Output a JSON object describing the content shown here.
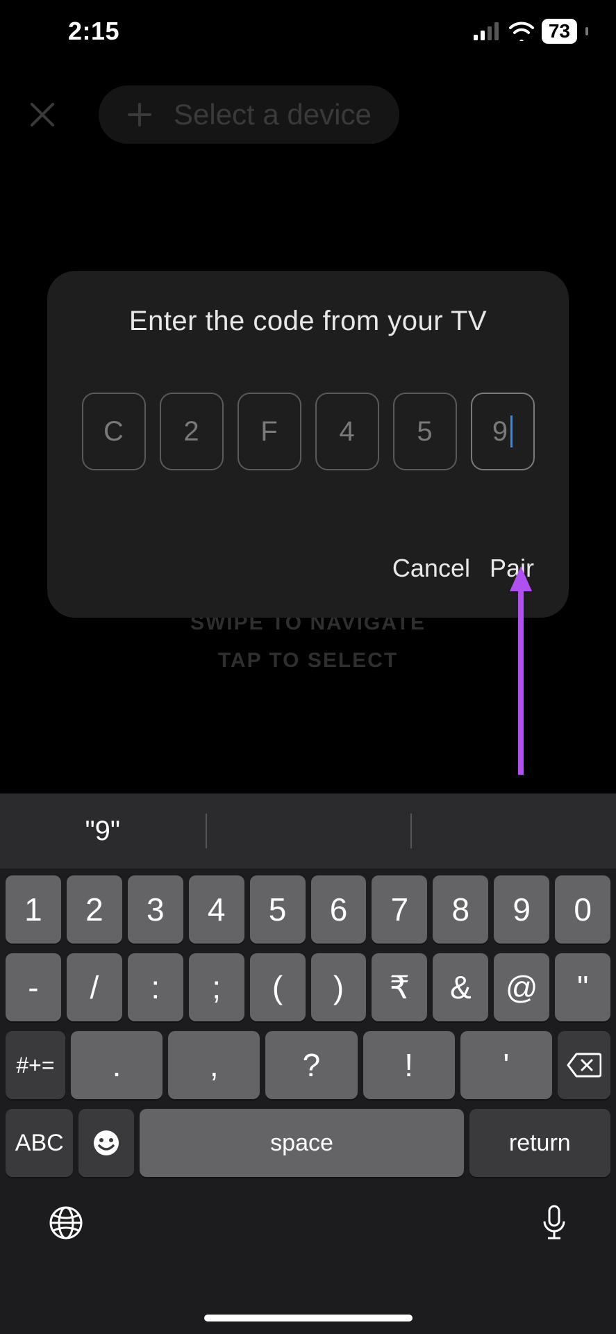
{
  "status": {
    "time": "2:15",
    "battery": "73"
  },
  "header": {
    "select_device": "Select a device"
  },
  "bg_hints": {
    "line1": "SWIPE TO NAVIGATE",
    "line2": "TAP TO SELECT"
  },
  "modal": {
    "title": "Enter the code from your TV",
    "code": [
      "C",
      "2",
      "F",
      "4",
      "5",
      "9"
    ],
    "active_index": 5,
    "cancel": "Cancel",
    "pair": "Pair"
  },
  "suggestion": "\"9\"",
  "keyboard": {
    "row1": [
      "1",
      "2",
      "3",
      "4",
      "5",
      "6",
      "7",
      "8",
      "9",
      "0"
    ],
    "row2": [
      "-",
      "/",
      ":",
      ";",
      "(",
      ")",
      "₹",
      "&",
      "@",
      "\""
    ],
    "row3_sym": "#+=",
    "row3": [
      ".",
      ",",
      "?",
      "!",
      "'"
    ],
    "abc": "ABC",
    "space": "space",
    "return": "return"
  }
}
